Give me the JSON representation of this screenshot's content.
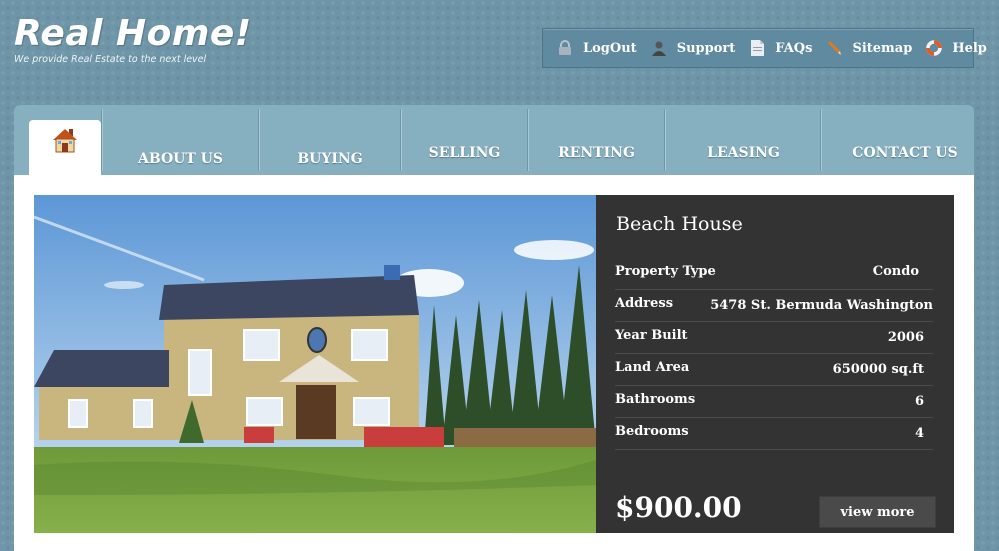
{
  "logo": {
    "title": "Real Home!",
    "tagline": "We provide Real Estate to the next level"
  },
  "toplinks": [
    {
      "label": "LogOut",
      "icon": "lock-icon"
    },
    {
      "label": "Support",
      "icon": "support-person-icon"
    },
    {
      "label": "FAQs",
      "icon": "document-icon"
    },
    {
      "label": "Sitemap",
      "icon": "pencil-icon"
    },
    {
      "label": "Help",
      "icon": "lifebuoy-icon"
    }
  ],
  "nav": {
    "home_icon": "house-icon",
    "items": [
      "ABOUT US",
      "BUYING",
      "SELLING",
      "RENTING",
      "LEASING",
      "CONTACT US"
    ]
  },
  "property": {
    "title": "Beach House",
    "details": [
      {
        "label": "Property Type",
        "value": "Condo"
      },
      {
        "label": "Address",
        "value": "5478 St. Bermuda Washington"
      },
      {
        "label": "Year Built",
        "value": "2006"
      },
      {
        "label": "Land Area",
        "value": "650000 sq.ft"
      },
      {
        "label": "Bathrooms",
        "value": "6"
      },
      {
        "label": "Bedrooms",
        "value": "4"
      }
    ],
    "price": "$900.00",
    "view_more": "view more"
  },
  "colors": {
    "background": "#6f96a8",
    "nav": "#86afbf",
    "panel": "#333333",
    "topbar": "#5f8aa0"
  }
}
